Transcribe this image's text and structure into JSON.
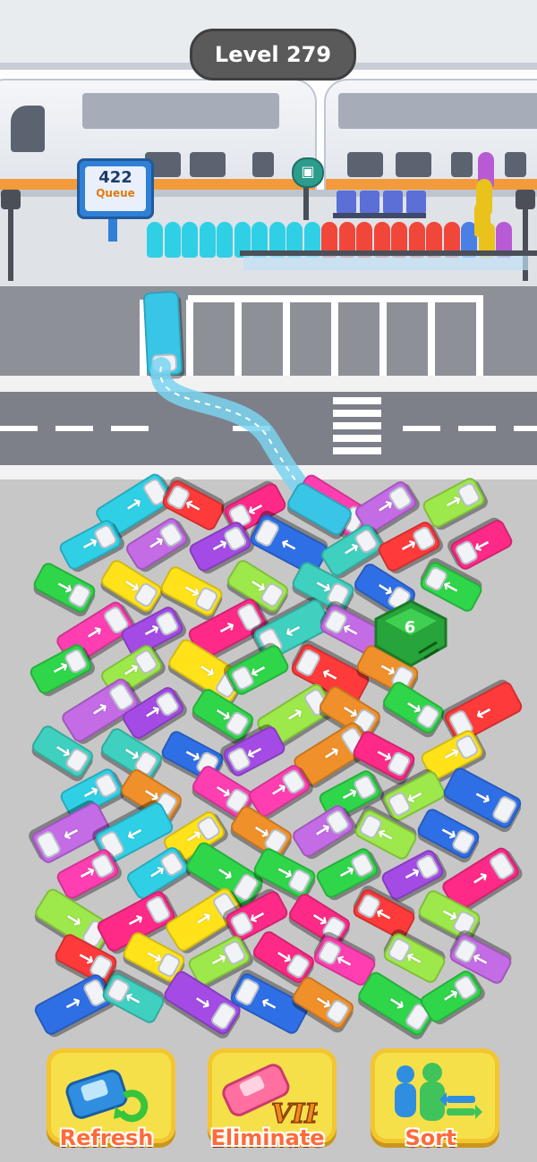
{
  "hud": {
    "level_label": "Level 279",
    "queue_count": "422",
    "queue_label": "Queue"
  },
  "board": {
    "mystery_box_count": "6"
  },
  "colors": {
    "brand_yellow": "#f6e04a",
    "label_orange": "#ff6a3a",
    "road_gray": "#7d8089",
    "lot_gray": "#c7c7c7"
  },
  "powerups": [
    {
      "label": "Refresh",
      "icon": "refresh-car-icon"
    },
    {
      "label": "Eliminate",
      "icon": "vip-car-icon"
    },
    {
      "label": "Sort",
      "icon": "sort-people-icon"
    }
  ],
  "queue_people_colors": [
    "cyan",
    "cyan",
    "cyan",
    "cyan",
    "cyan",
    "cyan",
    "cyan",
    "cyan",
    "cyan",
    "cyan",
    "red",
    "red",
    "red",
    "red",
    "red",
    "red",
    "red",
    "red",
    "blue",
    "yellow",
    "purple"
  ]
}
